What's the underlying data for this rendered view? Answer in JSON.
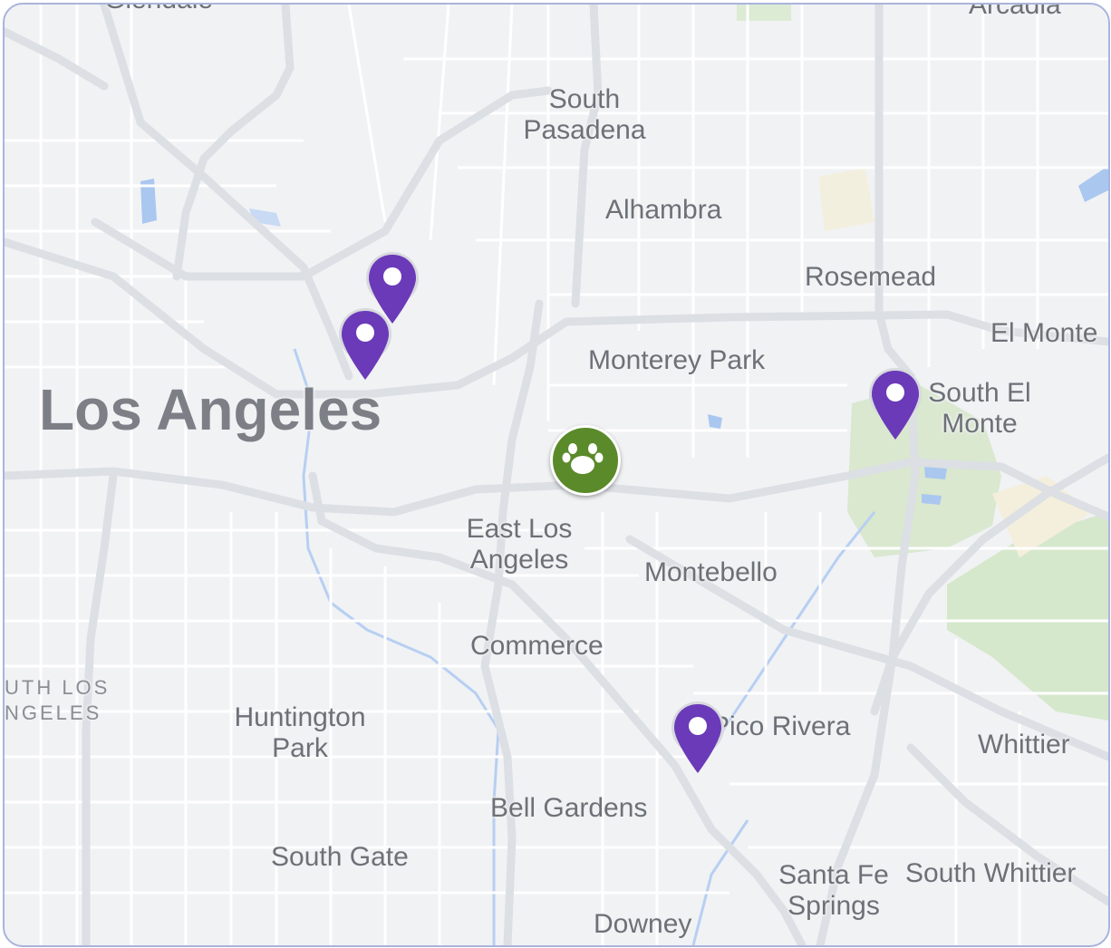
{
  "map": {
    "places": {
      "los_angeles": "Los Angeles",
      "glendale": "Glendale",
      "arcadia": "Arcadia",
      "south_pasadena": "South\nPasadena",
      "alhambra": "Alhambra",
      "rosemead": "Rosemead",
      "el_monte": "El Monte",
      "monterey_park": "Monterey Park",
      "south_el_monte": "South El\nMonte",
      "east_los_angeles": "East Los\nAngeles",
      "montebello": "Montebello",
      "commerce": "Commerce",
      "south_los_angeles": "UTH LOS\nNGELES",
      "huntington_park": "Huntington\nPark",
      "pico_rivera": "Pico Rivera",
      "whittier": "Whittier",
      "bell_gardens": "Bell Gardens",
      "south_gate": "South Gate",
      "santa_fe_springs": "Santa Fe\nSprings",
      "south_whittier": "South Whittier",
      "downey": "Downey"
    },
    "markers": [
      {
        "name": "location-pin",
        "color": "#6a3ab8"
      },
      {
        "name": "location-pin",
        "color": "#6a3ab8"
      },
      {
        "name": "location-pin",
        "color": "#6a3ab8"
      },
      {
        "name": "location-pin",
        "color": "#6a3ab8"
      }
    ],
    "center_marker": {
      "icon": "paw-icon",
      "color": "#5b8a2a"
    },
    "colors": {
      "background": "#f1f2f4",
      "road": "#ffffff",
      "highway": "#dcdfe4",
      "water": "#aac7f0",
      "park": "#cfe3c6",
      "frame_border": "#a9b4dc"
    }
  }
}
